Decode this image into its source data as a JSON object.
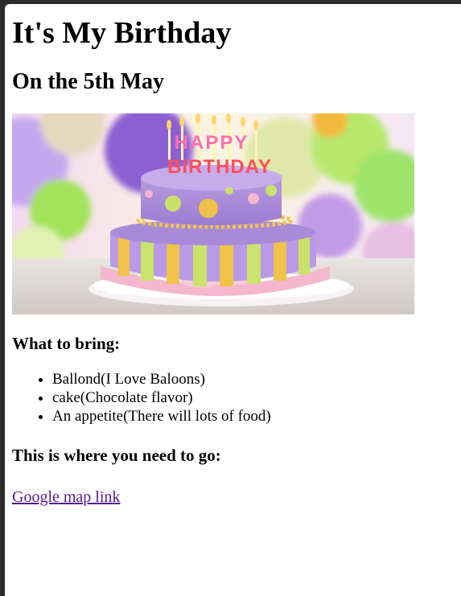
{
  "page": {
    "title": "It's My Birthday",
    "date_heading": "On the 5th May",
    "hero_image": {
      "alt": "Birthday cake",
      "cake_text_top": "HAPPY",
      "cake_text_bottom": "BIRTHDAY"
    },
    "bring_heading": "What to bring:",
    "bring_items": [
      "Ballond(I Love Baloons)",
      "cake(Chocolate flavor)",
      "An appetite(There will lots of food)"
    ],
    "go_heading": "This is where you need to go:",
    "map_link": "Google map link"
  },
  "colors": {
    "window_border": "#2b2b2b",
    "visited_link": "#551a8b"
  }
}
